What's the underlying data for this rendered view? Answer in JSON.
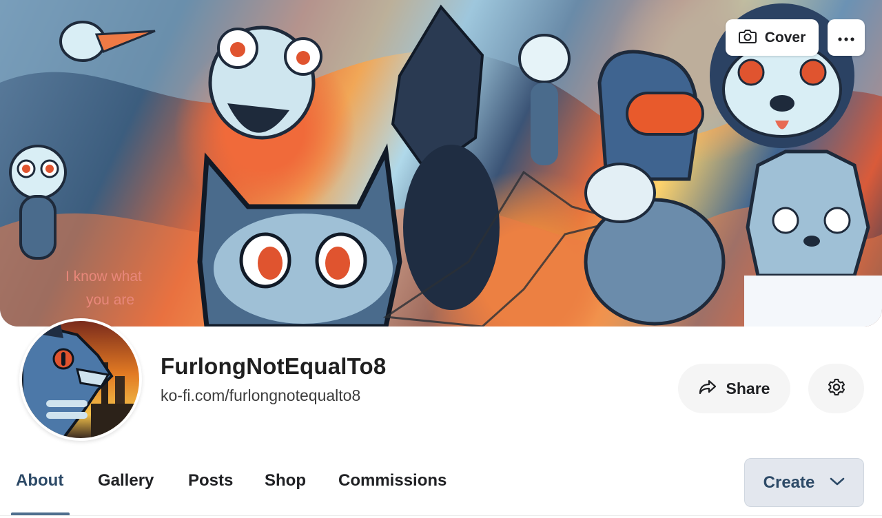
{
  "cover": {
    "change_label": "Cover",
    "camera_icon": "camera-icon",
    "more_icon": "more-horizontal-icon",
    "art_caption_line1": "I know what",
    "art_caption_line2": "you are"
  },
  "profile": {
    "name": "FurlongNotEqualTo8",
    "url": "ko-fi.com/furlongnotequalto8"
  },
  "actions": {
    "share_label": "Share",
    "share_icon": "share-arrow-icon",
    "settings_icon": "gear-icon"
  },
  "tabs": [
    {
      "label": "About",
      "active": true
    },
    {
      "label": "Gallery",
      "active": false
    },
    {
      "label": "Posts",
      "active": false
    },
    {
      "label": "Shop",
      "active": false
    },
    {
      "label": "Commissions",
      "active": false
    }
  ],
  "create": {
    "label": "Create",
    "icon": "chevron-down-icon"
  },
  "colors": {
    "accent": "#4f6e8e",
    "accent_text": "#2d4a67",
    "button_bg": "#f5f5f5"
  }
}
